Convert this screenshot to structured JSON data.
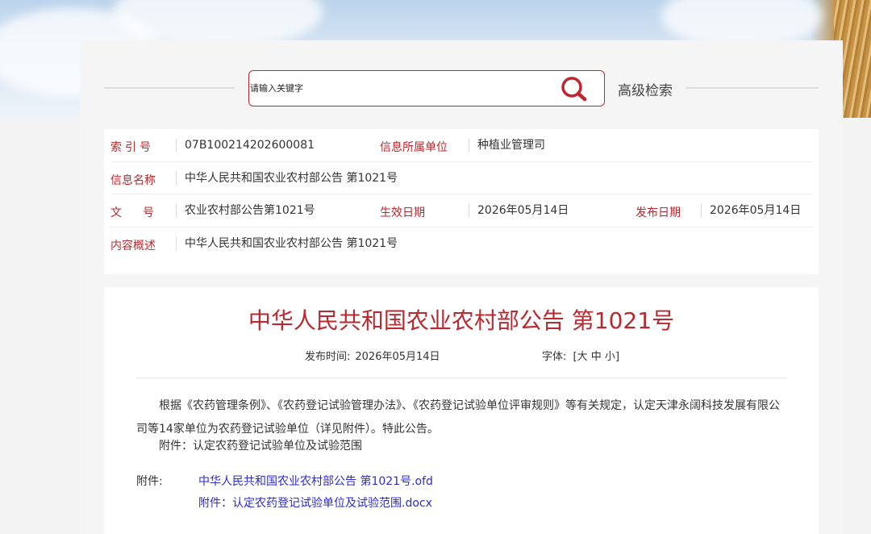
{
  "search": {
    "placeholder": "请输入关键字",
    "advanced_label": "高级检索"
  },
  "meta": {
    "index_label": "索引号",
    "index_value": "07B100214202600081",
    "unit_label": "信息所属单位",
    "unit_value": "种植业管理司",
    "name_label": "信息名称",
    "name_value": "中华人民共和国农业农村部公告 第1021号",
    "doc_label": "文号",
    "doc_value": "农业农村部公告第1021号",
    "effective_label": "生效日期",
    "effective_value": "2026年05月14日",
    "publish_label": "发布日期",
    "publish_value": "2026年05月14日",
    "summary_label": "内容概述",
    "summary_value": "中华人民共和国农业农村部公告 第1021号"
  },
  "article": {
    "title": "中华人民共和国农业农村部公告 第1021号",
    "pubtime_label": "发布时间:",
    "pubtime_value": "2026年05月14日",
    "font_label": "字体:",
    "font_open": "[",
    "font_large": "大",
    "font_medium": "中",
    "font_small": "小",
    "font_close": "]",
    "body": "根据《农药管理条例》、《农药登记试验管理办法》、《农药登记试验单位评审规则》等有关规定，认定天津永阔科技发展有限公司等14家单位为农药登记试验单位（详见附件）。特此公告。",
    "attachment_note": "附件：认定农药登记试验单位及试验范围",
    "attachments_label": "附件:",
    "attachments": [
      "中华人民共和国农业农村部公告 第1021号.ofd",
      "附件：认定农药登记试验单位及试验范围.docx"
    ]
  },
  "colors": {
    "accent_red": "#b82a2f",
    "link_blue": "#2b2bd6"
  }
}
